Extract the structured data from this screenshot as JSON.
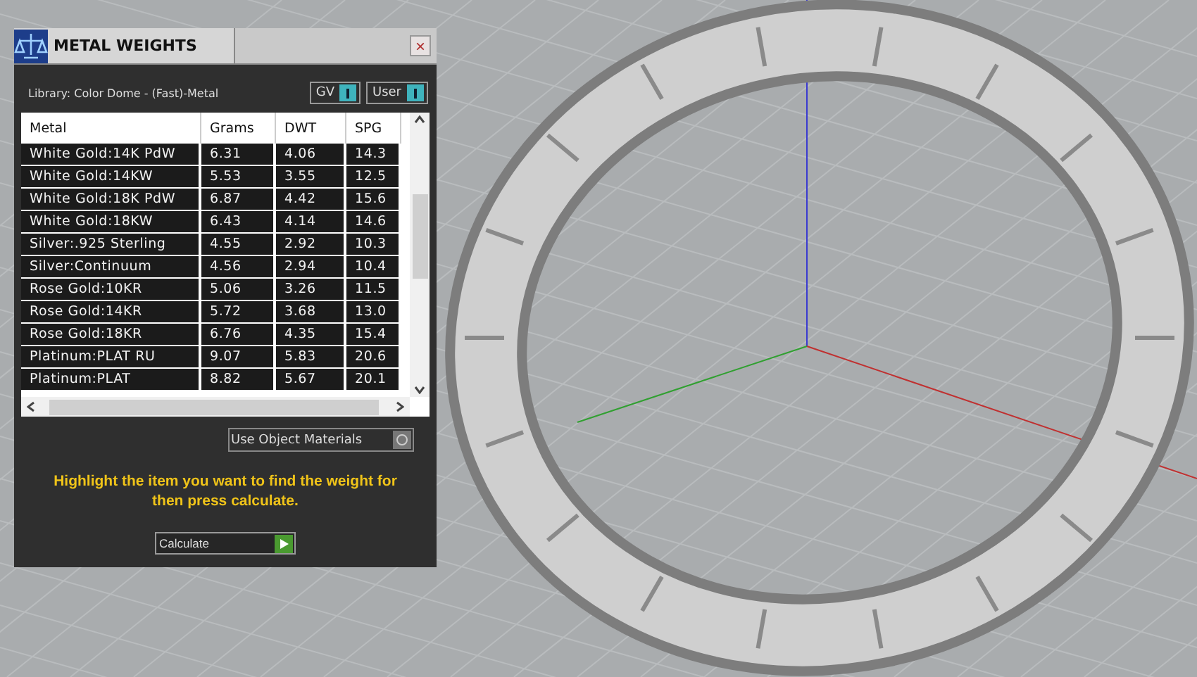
{
  "window": {
    "title": "METAL WEIGHTS",
    "close": "×"
  },
  "library": {
    "label": "Library: Color Dome - (Fast)-Metal"
  },
  "toggles": [
    {
      "label": "GV",
      "on": true
    },
    {
      "label": "User",
      "on": true
    }
  ],
  "table": {
    "columns": [
      "Metal",
      "Grams",
      "DWT",
      "SPG"
    ],
    "rows": [
      [
        "White Gold:14K PdW",
        "6.31",
        "4.06",
        "14.3"
      ],
      [
        "White Gold:14KW",
        "5.53",
        "3.55",
        "12.5"
      ],
      [
        "White Gold:18K PdW",
        "6.87",
        "4.42",
        "15.6"
      ],
      [
        "White Gold:18KW",
        "6.43",
        "4.14",
        "14.6"
      ],
      [
        "Silver:.925 Sterling",
        "4.55",
        "2.92",
        "10.3"
      ],
      [
        "Silver:Continuum",
        "4.56",
        "2.94",
        "10.4"
      ],
      [
        "Rose Gold:10KR",
        "5.06",
        "3.26",
        "11.5"
      ],
      [
        "Rose Gold:14KR",
        "5.72",
        "3.68",
        "13.0"
      ],
      [
        "Rose Gold:18KR",
        "6.76",
        "4.35",
        "15.4"
      ],
      [
        "Platinum:PLAT RU",
        "9.07",
        "5.83",
        "20.6"
      ],
      [
        "Platinum:PLAT",
        "8.82",
        "5.67",
        "20.1"
      ]
    ]
  },
  "use_object_materials": {
    "label": "Use Object Materials",
    "on": false
  },
  "hint": "Highlight the item you want to find the weight for then press calculate.",
  "calculate_button": "Calculate"
}
